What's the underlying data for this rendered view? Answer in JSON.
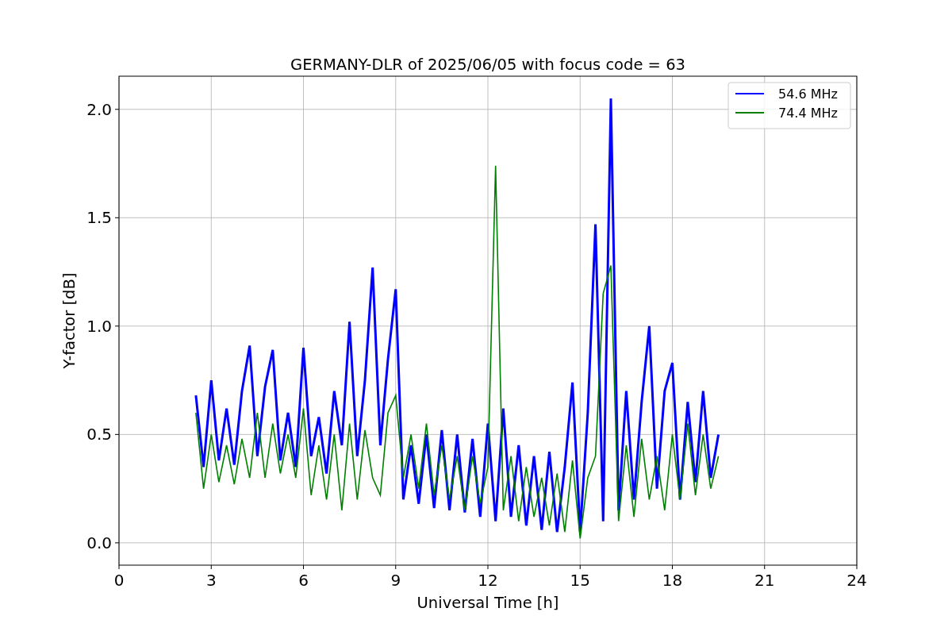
{
  "chart_data": {
    "type": "line",
    "title": "GERMANY-DLR of 2025/06/05 with focus code = 63",
    "xlabel": "Universal Time [h]",
    "ylabel": "Y-factor [dB]",
    "x": [
      2.5,
      2.75,
      3,
      3.25,
      3.5,
      3.75,
      4,
      4.25,
      4.5,
      4.75,
      5,
      5.25,
      5.5,
      5.75,
      6,
      6.25,
      6.5,
      6.75,
      7,
      7.25,
      7.5,
      7.75,
      8,
      8.25,
      8.5,
      8.75,
      9,
      9.25,
      9.5,
      9.75,
      10,
      10.25,
      10.5,
      10.75,
      11,
      11.25,
      11.5,
      11.75,
      12,
      12.25,
      12.5,
      12.75,
      13,
      13.25,
      13.5,
      13.75,
      14,
      14.25,
      14.5,
      14.75,
      15,
      15.25,
      15.5,
      15.75,
      16,
      16.25,
      16.5,
      16.75,
      17,
      17.25,
      17.5,
      17.75,
      18,
      18.25,
      18.5,
      18.75,
      19,
      19.25,
      19.5
    ],
    "series": [
      {
        "name": "54.6 MHz",
        "color": "#0000ff",
        "values": [
          0.68,
          0.35,
          0.75,
          0.38,
          0.62,
          0.36,
          0.7,
          0.91,
          0.4,
          0.72,
          0.89,
          0.38,
          0.6,
          0.35,
          0.9,
          0.4,
          0.58,
          0.32,
          0.7,
          0.45,
          1.02,
          0.4,
          0.75,
          1.27,
          0.45,
          0.85,
          1.17,
          0.2,
          0.45,
          0.18,
          0.5,
          0.16,
          0.52,
          0.15,
          0.5,
          0.14,
          0.48,
          0.12,
          0.55,
          0.1,
          0.62,
          0.12,
          0.45,
          0.08,
          0.4,
          0.06,
          0.42,
          0.05,
          0.35,
          0.74,
          0.05,
          0.6,
          1.47,
          0.1,
          2.05,
          0.15,
          0.7,
          0.2,
          0.65,
          1.0,
          0.25,
          0.7,
          0.83,
          0.2,
          0.65,
          0.28,
          0.7,
          0.3,
          0.5
        ]
      },
      {
        "name": "74.4 MHz",
        "color": "#008000",
        "values": [
          0.6,
          0.25,
          0.5,
          0.28,
          0.45,
          0.27,
          0.48,
          0.3,
          0.6,
          0.3,
          0.55,
          0.32,
          0.5,
          0.3,
          0.62,
          0.22,
          0.45,
          0.2,
          0.5,
          0.15,
          0.55,
          0.2,
          0.52,
          0.3,
          0.22,
          0.6,
          0.68,
          0.3,
          0.5,
          0.25,
          0.55,
          0.22,
          0.45,
          0.2,
          0.4,
          0.15,
          0.4,
          0.18,
          0.35,
          1.74,
          0.15,
          0.4,
          0.1,
          0.35,
          0.12,
          0.3,
          0.08,
          0.32,
          0.05,
          0.38,
          0.02,
          0.3,
          0.4,
          1.15,
          1.28,
          0.1,
          0.45,
          0.12,
          0.48,
          0.2,
          0.4,
          0.15,
          0.5,
          0.2,
          0.55,
          0.22,
          0.5,
          0.25,
          0.4
        ]
      }
    ],
    "grid": true,
    "legend": true,
    "xlim": [
      0,
      24
    ],
    "ylim": [
      -0.103,
      2.153
    ],
    "xticks": [
      0,
      3,
      6,
      9,
      12,
      15,
      18,
      21,
      24
    ],
    "yticks": [
      {
        "value": 0,
        "label": "0.0"
      },
      {
        "value": 0.5,
        "label": "0.5"
      },
      {
        "value": 1,
        "label": "1.0"
      },
      {
        "value": 1.5,
        "label": "1.5"
      },
      {
        "value": 2,
        "label": "2.0"
      }
    ]
  }
}
